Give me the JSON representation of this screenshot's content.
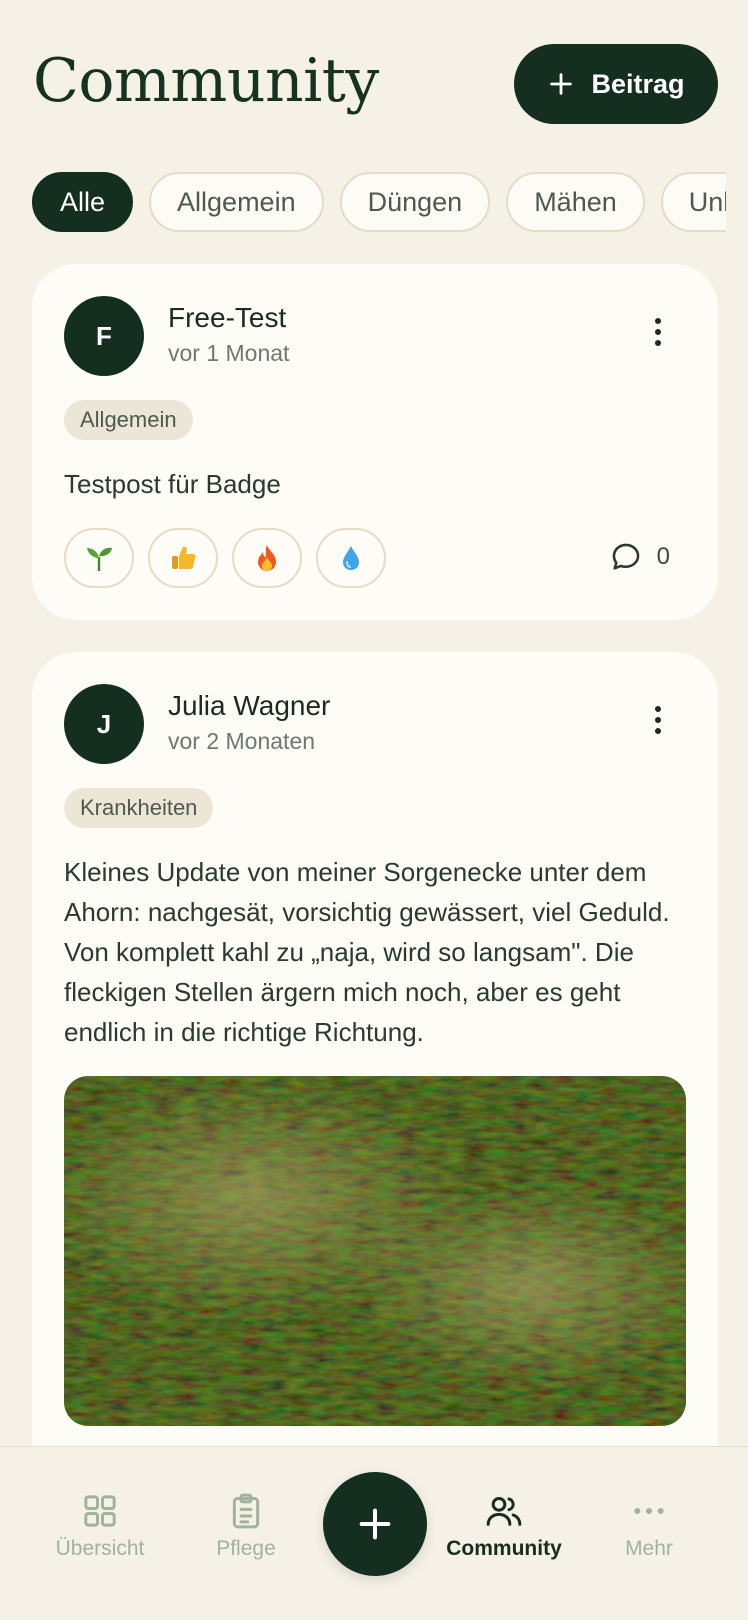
{
  "header": {
    "title": "Community",
    "new_post_label": "Beitrag"
  },
  "filters": [
    "Alle",
    "Allgemein",
    "Düngen",
    "Mähen",
    "Unkraut"
  ],
  "active_filter": "Alle",
  "posts": [
    {
      "avatar_initial": "F",
      "author": "Free-Test",
      "time": "vor 1 Monat",
      "tag": "Allgemein",
      "text": "Testpost für Badge",
      "reactions": [
        "seedling-icon",
        "thumbs-up-icon",
        "fire-icon",
        "droplet-icon"
      ],
      "comment_count": "0"
    },
    {
      "avatar_initial": "J",
      "author": "Julia Wagner",
      "time": "vor 2 Monaten",
      "tag": "Krankheiten",
      "text": "Kleines Update von meiner Sorgenecke unter dem Ahorn: nachgesät, vorsichtig gewässert, viel Geduld. Von komplett kahl zu „naja, wird so langsam\". Die fleckigen Stellen ärgern mich noch, aber es geht endlich in die richtige Richtung."
    }
  ],
  "nav": {
    "overview": "Übersicht",
    "care": "Pflege",
    "community": "Community",
    "more": "Mehr",
    "active": "community"
  },
  "colors": {
    "background": "#f6f1e7",
    "primary": "#142e1f",
    "card": "#fdfcf6",
    "chip_border": "#e5dcc4",
    "tag_bg": "#ece6d6",
    "nav_inactive": "#a2b39d"
  }
}
